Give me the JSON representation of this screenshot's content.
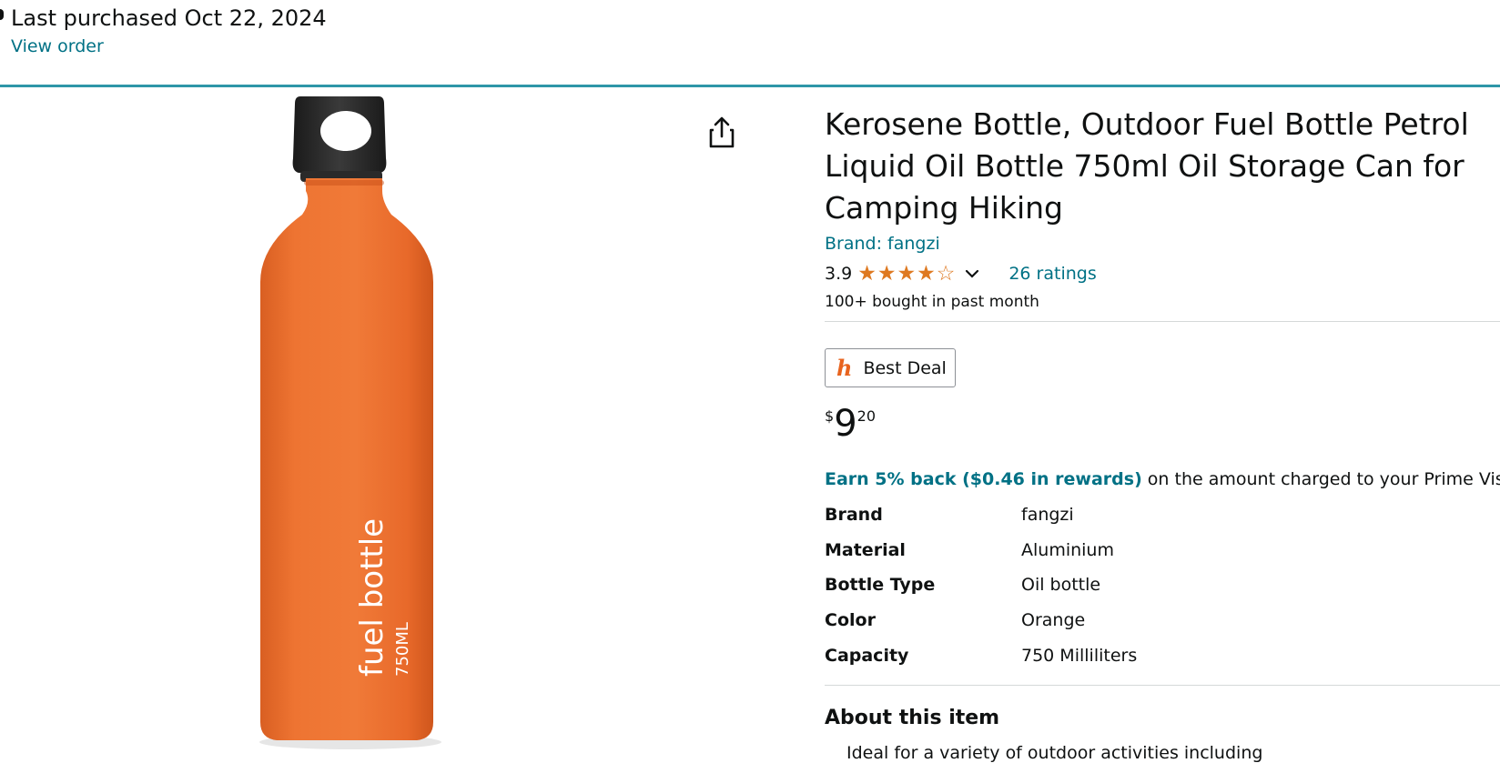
{
  "purchase_banner": {
    "last_purchased": "Last purchased Oct 22, 2024",
    "view_order": "View order"
  },
  "product": {
    "title": "Kerosene Bottle, Outdoor Fuel Bottle Petrol Liquid Oil Bottle 750ml Oil Storage Can for Camping Hiking",
    "brand_link": "Brand: fangzi",
    "rating_value": "3.9",
    "rating_stars": 3.9,
    "ratings_count": "26 ratings",
    "bought_past_month": "100+ bought in past month",
    "image_text": {
      "main": "fuel bottle",
      "capacity": "750ML"
    }
  },
  "deal_badge": {
    "label": "Best Deal",
    "logo": "h"
  },
  "price": {
    "symbol": "$",
    "whole": "9",
    "fraction": "20"
  },
  "rewards": {
    "highlight": "Earn 5% back ($0.46 in rewards)",
    "text": " on the amount charged to your Prime Visa."
  },
  "specs": [
    {
      "label": "Brand",
      "value": "fangzi"
    },
    {
      "label": "Material",
      "value": "Aluminium"
    },
    {
      "label": "Bottle Type",
      "value": "Oil bottle"
    },
    {
      "label": "Color",
      "value": "Orange"
    },
    {
      "label": "Capacity",
      "value": "750 Milliliters"
    }
  ],
  "about": {
    "heading": "About this item",
    "first_bullet": "Ideal for a variety of outdoor activities including"
  },
  "icons": {
    "share": "share-icon",
    "chevron": "chevron-down-icon",
    "star_color": "#de7921"
  },
  "colors": {
    "link": "#007185",
    "accent_line": "#2e96a8",
    "bottle": "#ee7432"
  }
}
